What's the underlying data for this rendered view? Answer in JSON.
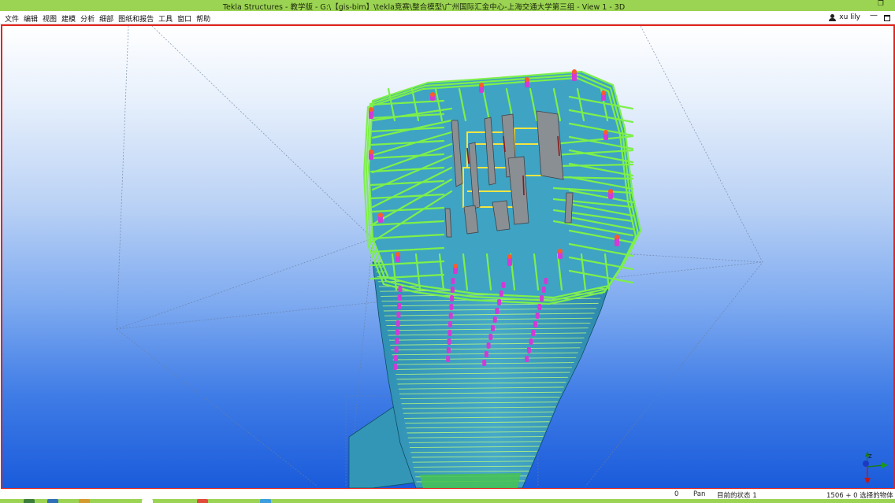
{
  "window": {
    "title": "Tekla Structures - 教学版 - G:\\【gis-bim】\\tekla竞赛\\整合模型\\广州国际汇金中心-上海交通大学第三组 - View 1 - 3D"
  },
  "menu": {
    "items": [
      "文件",
      "编辑",
      "视图",
      "建模",
      "分析",
      "细部",
      "图纸和报告",
      "工具",
      "窗口",
      "帮助"
    ]
  },
  "user": {
    "name": "xu lily"
  },
  "view": {
    "name": "View 1 - 3D",
    "axes": {
      "z": "Z",
      "x": "X",
      "y": "Y"
    }
  },
  "status": {
    "count": "0",
    "mode": "Pan",
    "state": "目前的状态 1",
    "selection": "1506 + 0 选择的物体"
  },
  "colors": {
    "title_bar": "#9bd352",
    "viewport_border": "#e3231c",
    "floor_slab": "#3fa3c4",
    "beams": "#7df04a",
    "columns": "#d23ad6",
    "core_walls": "#8a8f94",
    "core_beams": "#f4e542"
  }
}
